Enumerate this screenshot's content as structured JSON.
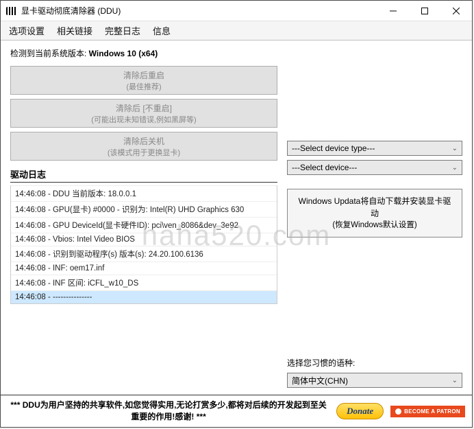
{
  "titlebar": {
    "title": "显卡驱动彻底清除器 (DDU)"
  },
  "menu": {
    "options": "选项设置",
    "links": "相关链接",
    "log": "完整日志",
    "info": "信息"
  },
  "sys": {
    "prefix": "检测到当前系统版本: ",
    "version": "Windows 10 (x64)"
  },
  "buttons": {
    "b1l1": "清除后重启",
    "b1l2": "(最佳推荐)",
    "b2l1": "清除后 [不重启]",
    "b2l2": "(可能出现未知错误,例如黑屏等)",
    "b3l1": "清除后关机",
    "b3l2": "(该模式用于更换显卡)"
  },
  "logtitle": "驱动日志",
  "logs": [
    "14:46:08 - DDU 当前版本: 18.0.0.1",
    "14:46:08 - GPU(显卡) #0000 - 识别为: Intel(R) UHD Graphics 630",
    "14:46:08 - GPU DeviceId(显卡硬件ID): pci\\ven_8086&dev_3e92",
    "14:46:08 - Vbios: Intel Video BIOS",
    "14:46:08 - 识别到驱动程序(s) 版本(s): 24.20.100.6136",
    "14:46:08 - INF: oem17.inf",
    "14:46:08 - INF 区间: iCFL_w10_DS",
    "14:46:08 - ---------------"
  ],
  "right": {
    "devtype": "---Select device type---",
    "dev": "---Select device---",
    "winupd1": "Windows Updata将自动下载并安装显卡驱动",
    "winupd2": "(恢复Windows默认设置)",
    "langlabel": "选择您习惯的语种:",
    "lang": "简体中文(CHN)"
  },
  "footer": {
    "msg": "*** DDU为用户坚持的共享软件,如您觉得实用,无论打赏多少,都将对后续的开发起到至关重要的作用!感谢! ***",
    "donate": "Donate",
    "patron": "BECOME A PATRON"
  },
  "watermark": "haha520.com"
}
